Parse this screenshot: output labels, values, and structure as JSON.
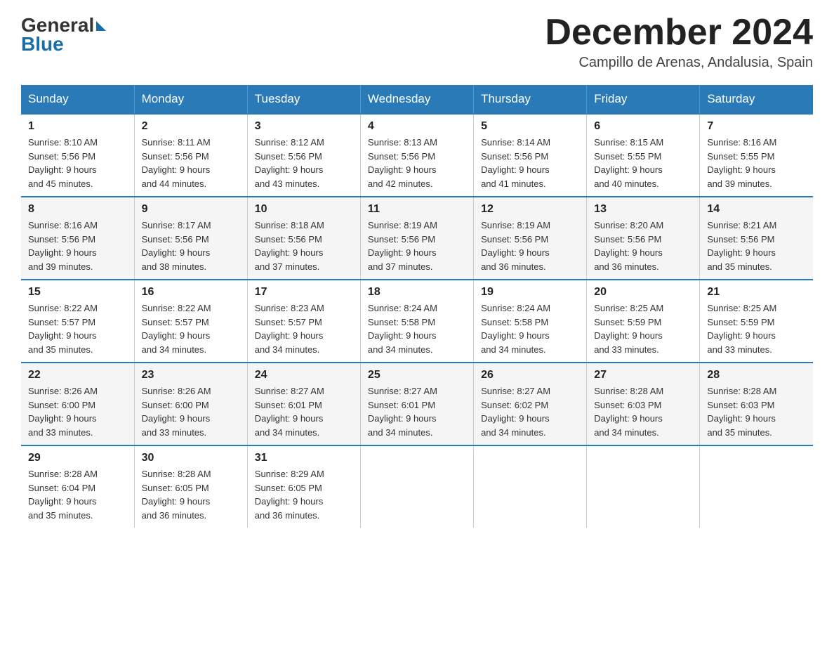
{
  "logo": {
    "general": "General",
    "blue": "Blue"
  },
  "title": "December 2024",
  "location": "Campillo de Arenas, Andalusia, Spain",
  "headers": [
    "Sunday",
    "Monday",
    "Tuesday",
    "Wednesday",
    "Thursday",
    "Friday",
    "Saturday"
  ],
  "weeks": [
    [
      {
        "day": "1",
        "info": "Sunrise: 8:10 AM\nSunset: 5:56 PM\nDaylight: 9 hours\nand 45 minutes."
      },
      {
        "day": "2",
        "info": "Sunrise: 8:11 AM\nSunset: 5:56 PM\nDaylight: 9 hours\nand 44 minutes."
      },
      {
        "day": "3",
        "info": "Sunrise: 8:12 AM\nSunset: 5:56 PM\nDaylight: 9 hours\nand 43 minutes."
      },
      {
        "day": "4",
        "info": "Sunrise: 8:13 AM\nSunset: 5:56 PM\nDaylight: 9 hours\nand 42 minutes."
      },
      {
        "day": "5",
        "info": "Sunrise: 8:14 AM\nSunset: 5:56 PM\nDaylight: 9 hours\nand 41 minutes."
      },
      {
        "day": "6",
        "info": "Sunrise: 8:15 AM\nSunset: 5:55 PM\nDaylight: 9 hours\nand 40 minutes."
      },
      {
        "day": "7",
        "info": "Sunrise: 8:16 AM\nSunset: 5:55 PM\nDaylight: 9 hours\nand 39 minutes."
      }
    ],
    [
      {
        "day": "8",
        "info": "Sunrise: 8:16 AM\nSunset: 5:56 PM\nDaylight: 9 hours\nand 39 minutes."
      },
      {
        "day": "9",
        "info": "Sunrise: 8:17 AM\nSunset: 5:56 PM\nDaylight: 9 hours\nand 38 minutes."
      },
      {
        "day": "10",
        "info": "Sunrise: 8:18 AM\nSunset: 5:56 PM\nDaylight: 9 hours\nand 37 minutes."
      },
      {
        "day": "11",
        "info": "Sunrise: 8:19 AM\nSunset: 5:56 PM\nDaylight: 9 hours\nand 37 minutes."
      },
      {
        "day": "12",
        "info": "Sunrise: 8:19 AM\nSunset: 5:56 PM\nDaylight: 9 hours\nand 36 minutes."
      },
      {
        "day": "13",
        "info": "Sunrise: 8:20 AM\nSunset: 5:56 PM\nDaylight: 9 hours\nand 36 minutes."
      },
      {
        "day": "14",
        "info": "Sunrise: 8:21 AM\nSunset: 5:56 PM\nDaylight: 9 hours\nand 35 minutes."
      }
    ],
    [
      {
        "day": "15",
        "info": "Sunrise: 8:22 AM\nSunset: 5:57 PM\nDaylight: 9 hours\nand 35 minutes."
      },
      {
        "day": "16",
        "info": "Sunrise: 8:22 AM\nSunset: 5:57 PM\nDaylight: 9 hours\nand 34 minutes."
      },
      {
        "day": "17",
        "info": "Sunrise: 8:23 AM\nSunset: 5:57 PM\nDaylight: 9 hours\nand 34 minutes."
      },
      {
        "day": "18",
        "info": "Sunrise: 8:24 AM\nSunset: 5:58 PM\nDaylight: 9 hours\nand 34 minutes."
      },
      {
        "day": "19",
        "info": "Sunrise: 8:24 AM\nSunset: 5:58 PM\nDaylight: 9 hours\nand 34 minutes."
      },
      {
        "day": "20",
        "info": "Sunrise: 8:25 AM\nSunset: 5:59 PM\nDaylight: 9 hours\nand 33 minutes."
      },
      {
        "day": "21",
        "info": "Sunrise: 8:25 AM\nSunset: 5:59 PM\nDaylight: 9 hours\nand 33 minutes."
      }
    ],
    [
      {
        "day": "22",
        "info": "Sunrise: 8:26 AM\nSunset: 6:00 PM\nDaylight: 9 hours\nand 33 minutes."
      },
      {
        "day": "23",
        "info": "Sunrise: 8:26 AM\nSunset: 6:00 PM\nDaylight: 9 hours\nand 33 minutes."
      },
      {
        "day": "24",
        "info": "Sunrise: 8:27 AM\nSunset: 6:01 PM\nDaylight: 9 hours\nand 34 minutes."
      },
      {
        "day": "25",
        "info": "Sunrise: 8:27 AM\nSunset: 6:01 PM\nDaylight: 9 hours\nand 34 minutes."
      },
      {
        "day": "26",
        "info": "Sunrise: 8:27 AM\nSunset: 6:02 PM\nDaylight: 9 hours\nand 34 minutes."
      },
      {
        "day": "27",
        "info": "Sunrise: 8:28 AM\nSunset: 6:03 PM\nDaylight: 9 hours\nand 34 minutes."
      },
      {
        "day": "28",
        "info": "Sunrise: 8:28 AM\nSunset: 6:03 PM\nDaylight: 9 hours\nand 35 minutes."
      }
    ],
    [
      {
        "day": "29",
        "info": "Sunrise: 8:28 AM\nSunset: 6:04 PM\nDaylight: 9 hours\nand 35 minutes."
      },
      {
        "day": "30",
        "info": "Sunrise: 8:28 AM\nSunset: 6:05 PM\nDaylight: 9 hours\nand 36 minutes."
      },
      {
        "day": "31",
        "info": "Sunrise: 8:29 AM\nSunset: 6:05 PM\nDaylight: 9 hours\nand 36 minutes."
      },
      {
        "day": "",
        "info": ""
      },
      {
        "day": "",
        "info": ""
      },
      {
        "day": "",
        "info": ""
      },
      {
        "day": "",
        "info": ""
      }
    ]
  ]
}
